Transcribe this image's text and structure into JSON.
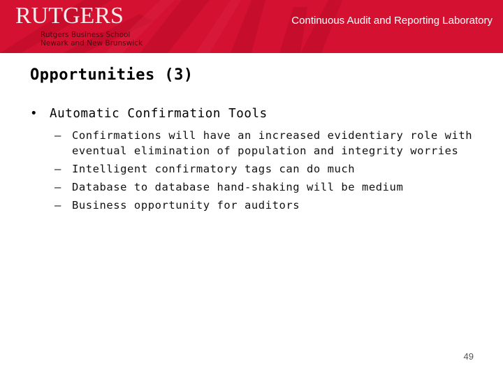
{
  "header": {
    "logo_text": "RUTGERS",
    "school_line1": "Rutgers Business School",
    "school_line2": "Newark and New Brunswick",
    "lab_title": "Continuous Audit and Reporting Laboratory",
    "banner_color": "#d41131"
  },
  "slide": {
    "title": "Opportunities (3)",
    "bullet": {
      "marker": "•",
      "text": "Automatic Confirmation Tools",
      "sub_items": [
        "Confirmations will have an increased evidentiary role with eventual elimination of population and integrity worries",
        "Intelligent confirmatory tags can do much",
        "Database to database hand-shaking will be medium",
        "Business opportunity for auditors"
      ],
      "sub_marker": "–"
    },
    "page_number": "49"
  }
}
